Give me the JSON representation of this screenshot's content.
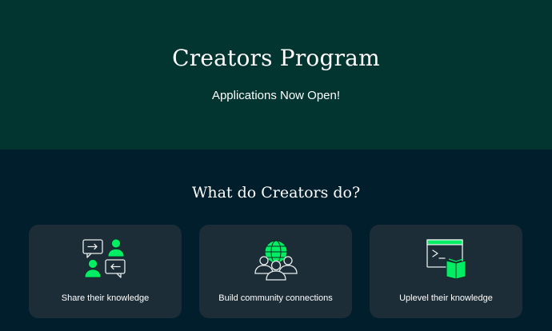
{
  "hero": {
    "title": "Creators Program",
    "subtitle": "Applications Now Open!"
  },
  "section": {
    "title": "What do Creators do?",
    "cards": [
      {
        "label": "Share their knowledge",
        "icon": "people-chat-icon"
      },
      {
        "label": "Build community connections",
        "icon": "community-globe-icon"
      },
      {
        "label": "Uplevel their knowledge",
        "icon": "terminal-book-icon"
      }
    ]
  },
  "colors": {
    "hero_bg": "#023430",
    "section_bg": "#001e2b",
    "card_bg": "#1c2d38",
    "accent": "#00ed64"
  }
}
